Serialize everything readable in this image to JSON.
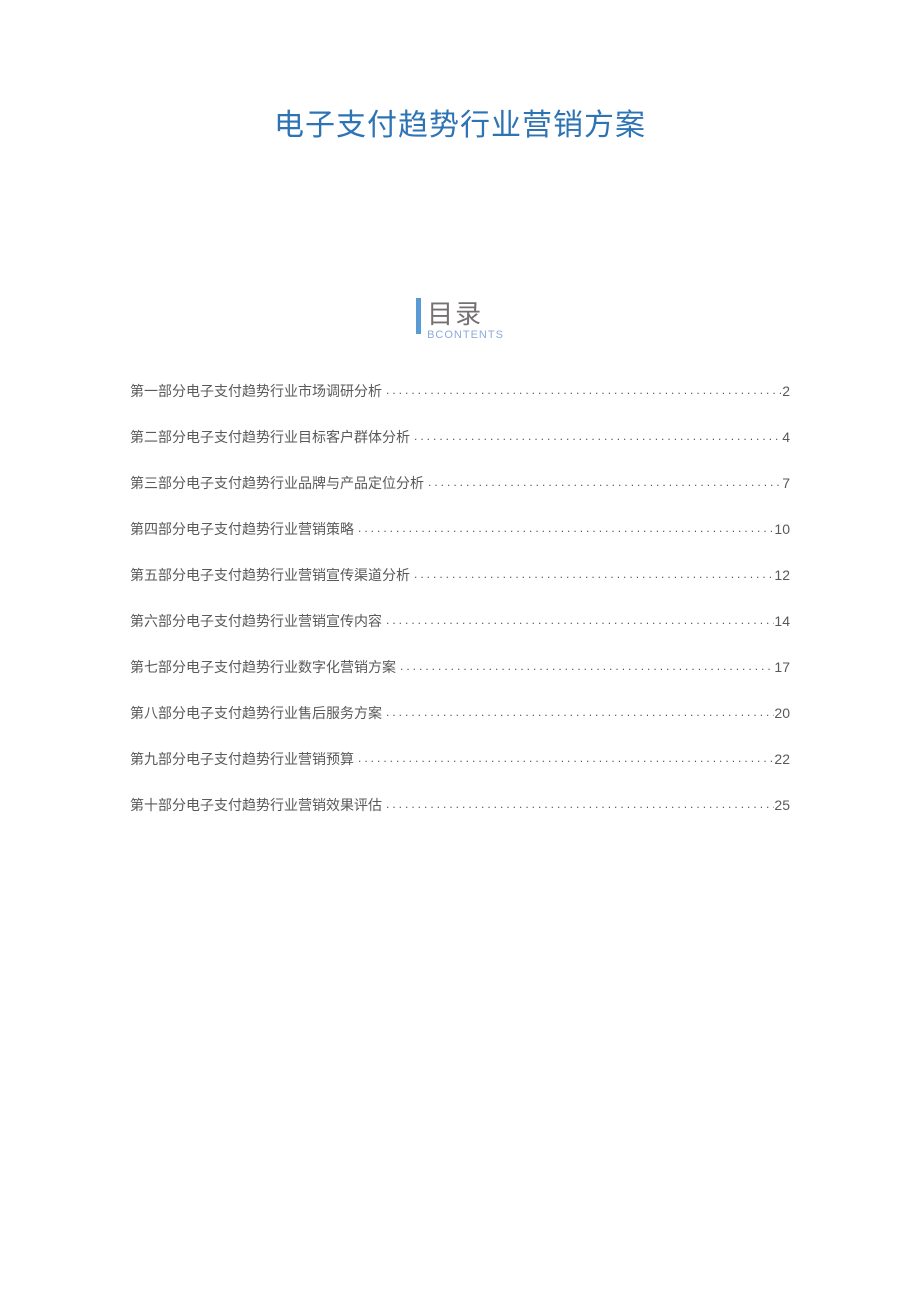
{
  "title": "电子支付趋势行业营销方案",
  "toc": {
    "label": "目录",
    "sublabel": "BCONTENTS",
    "items": [
      {
        "text": "第一部分电子支付趋势行业市场调研分析",
        "page": "2"
      },
      {
        "text": "第二部分电子支付趋势行业目标客户群体分析",
        "page": "4"
      },
      {
        "text": "第三部分电子支付趋势行业品牌与产品定位分析",
        "page": "7"
      },
      {
        "text": "第四部分电子支付趋势行业营销策略",
        "page": "10"
      },
      {
        "text": "第五部分电子支付趋势行业营销宣传渠道分析",
        "page": "12"
      },
      {
        "text": "第六部分电子支付趋势行业营销宣传内容",
        "page": "14"
      },
      {
        "text": "第七部分电子支付趋势行业数字化营销方案",
        "page": "17"
      },
      {
        "text": "第八部分电子支付趋势行业售后服务方案",
        "page": "20"
      },
      {
        "text": "第九部分电子支付趋势行业营销预算",
        "page": "22"
      },
      {
        "text": "第十部分电子支付趋势行业营销效果评估",
        "page": "25"
      }
    ]
  }
}
